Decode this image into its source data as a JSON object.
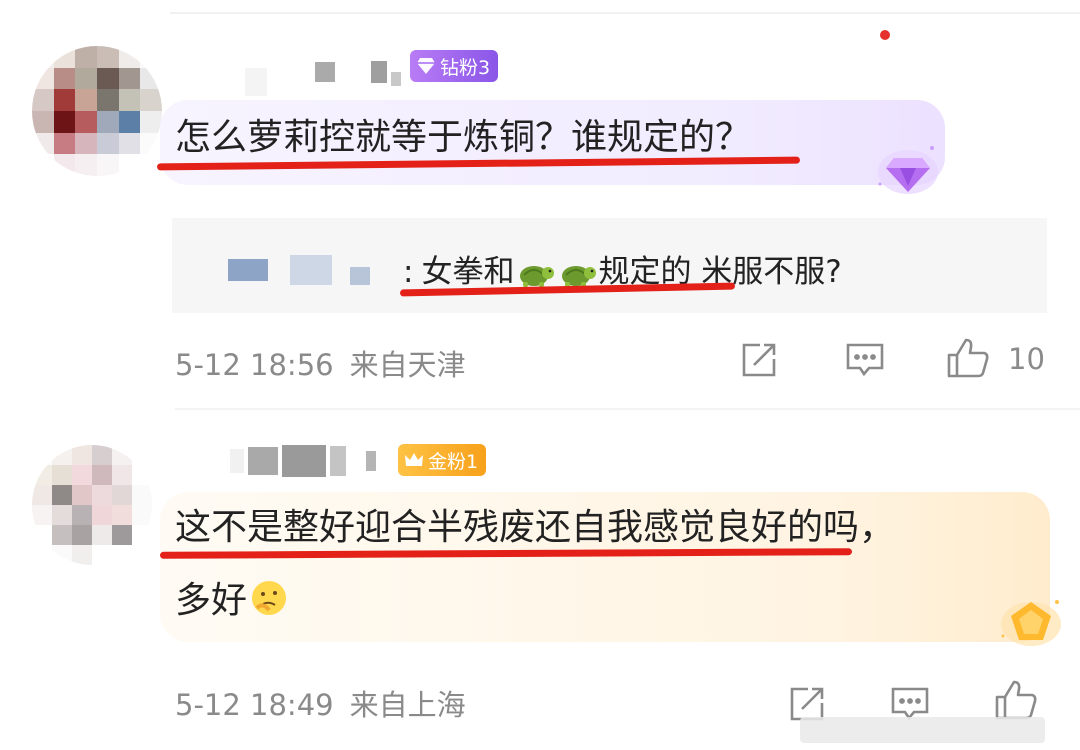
{
  "comments": [
    {
      "badge": {
        "label": "钻粉3",
        "icon": "diamond-icon",
        "color": "#a46af0"
      },
      "text": "怎么萝莉控就等于炼铜？谁规定的？",
      "reply": {
        "prefix": ":",
        "text_before": "女拳和",
        "emoji": "turtle-emoji",
        "text_after": "规定的 米服不服?"
      },
      "time": "5-12 18:56",
      "location": "来自天津",
      "likes": "10"
    },
    {
      "badge": {
        "label": "金粉1",
        "icon": "crown-icon",
        "color": "#f7a11b"
      },
      "text_line1": "这不是整好迎合半残废还自我感觉良好的吗，",
      "text_line2": "多好",
      "emoji": "thinking-face-emoji",
      "time": "5-12 18:49",
      "location": "来自上海",
      "likes": ""
    }
  ],
  "colors": {
    "underline": "#e32118",
    "meta": "#8a8a8a",
    "diamond_badge": "#a46af0",
    "gold_badge": "#f7a11b"
  }
}
